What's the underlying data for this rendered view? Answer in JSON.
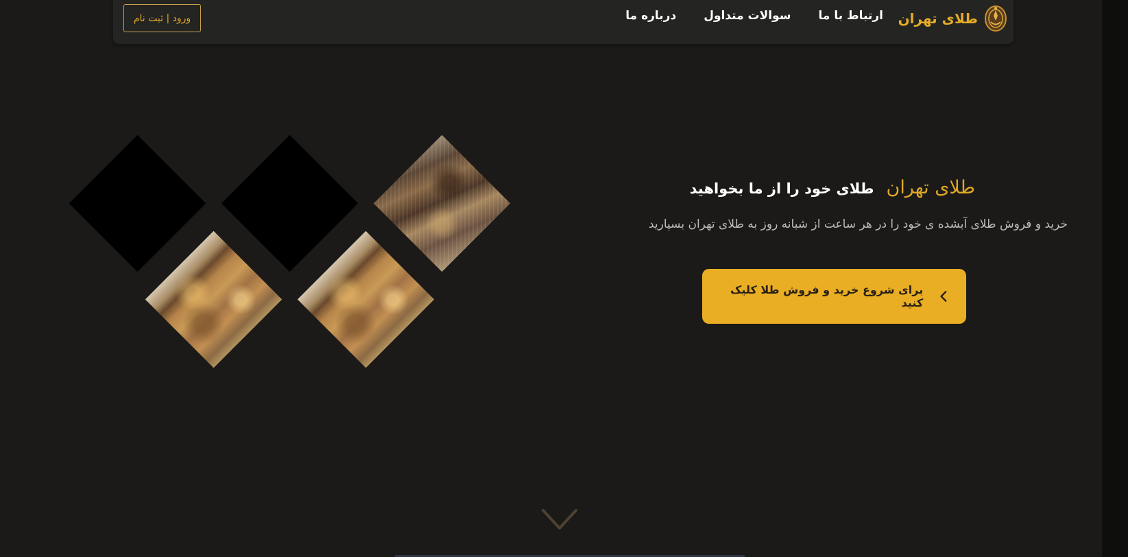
{
  "header": {
    "brand_name": "طلای تهران",
    "logo_icon": "gold-crest-logo",
    "nav": [
      {
        "label": "درباره ما"
      },
      {
        "label": "سوالات متداول"
      },
      {
        "label": "ارتباط با ما"
      }
    ],
    "auth_label": "ورود | ثبت نام"
  },
  "hero": {
    "title_brand": "طلای تهران",
    "title_text": "طلای خود را از ما بخواهید",
    "subtitle": "خرید و فروش طلای آبشده ی خود را در هر ساعت از شبانه روز به طلای تهران بسپارید",
    "cta_label": "برای شروع خرید و فروش طلا کلیک کنید",
    "cta_icon": "chevron-left-icon"
  },
  "mosaic_icons": [
    "gold-texture-image"
  ],
  "scroll_icon": "chevron-down-icon",
  "colors": {
    "background": "#1b1a18",
    "navbar": "#242422",
    "accent_gold": "#eaae24",
    "brand_gold": "#e5ac2a",
    "text_white": "#ffffff",
    "text_muted": "#bcbcbc"
  }
}
